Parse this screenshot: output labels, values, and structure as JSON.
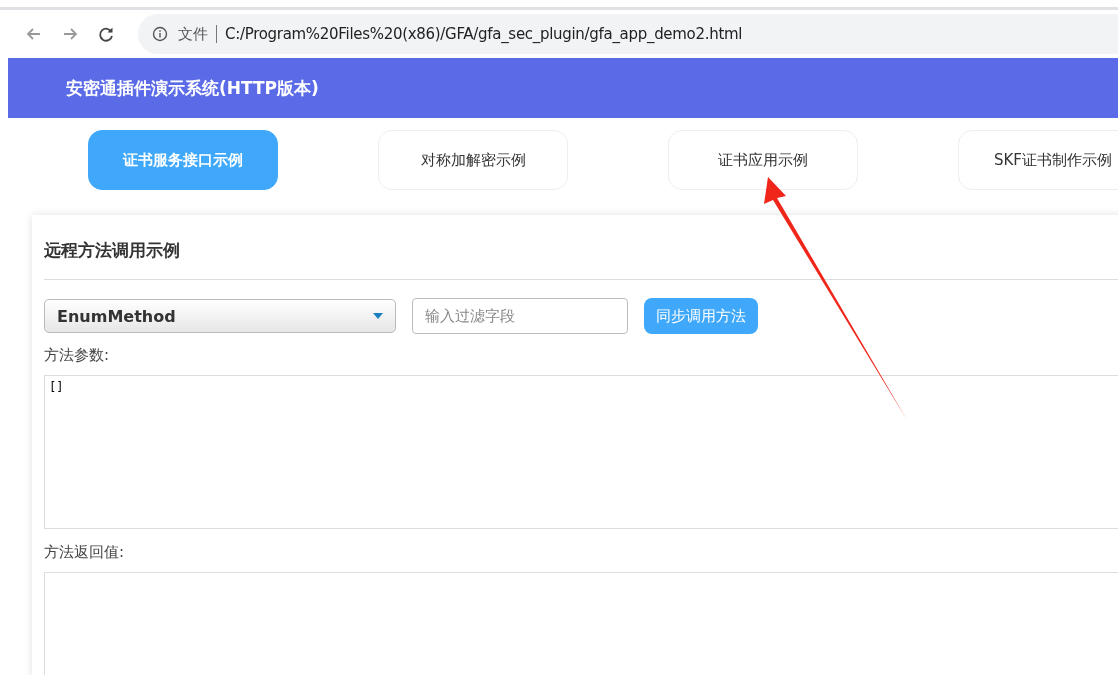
{
  "browser": {
    "security_label": "文件",
    "url": "C:/Program%20Files%20(x86)/GFA/gfa_sec_plugin/gfa_app_demo2.html"
  },
  "header": {
    "title": "安密通插件演示系统(HTTP版本)"
  },
  "tabs": [
    {
      "label": "证书服务接口示例",
      "selected": true
    },
    {
      "label": "对称加解密示例",
      "selected": false
    },
    {
      "label": "证书应用示例",
      "selected": false
    },
    {
      "label": "SKF证书制作示例",
      "selected": false
    }
  ],
  "panel": {
    "title": "远程方法调用示例",
    "method_select": {
      "value": "EnumMethod"
    },
    "filter": {
      "placeholder": "输入过滤字段"
    },
    "call_button": "同步调用方法",
    "params_label": "方法参数:",
    "params_value": "[]",
    "result_label": "方法返回值:"
  }
}
